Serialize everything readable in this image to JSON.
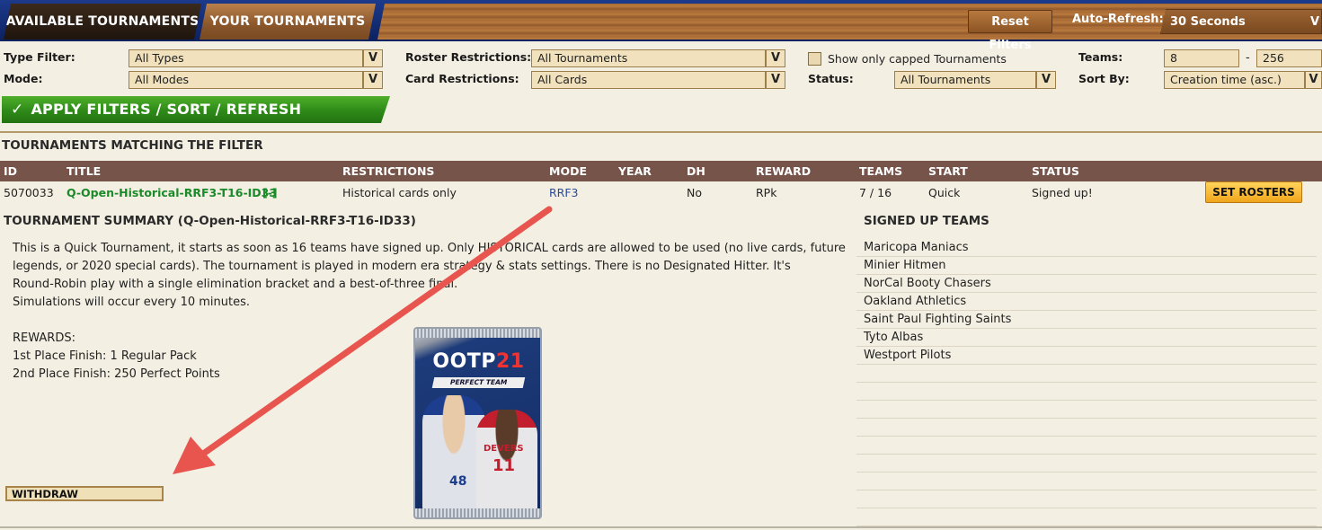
{
  "tabs": {
    "available": "AVAILABLE TOURNAMENTS",
    "yours": "YOUR TOURNAMENTS"
  },
  "toolbar": {
    "reset_filters": "Reset Filters",
    "auto_refresh_label": "Auto-Refresh:",
    "auto_refresh_value": "30 Seconds"
  },
  "filters": {
    "type_filter_label": "Type Filter:",
    "type_filter_value": "All Types",
    "mode_label": "Mode:",
    "mode_value": "All Modes",
    "roster_restrictions_label": "Roster Restrictions:",
    "roster_restrictions_value": "All Tournaments",
    "card_restrictions_label": "Card Restrictions:",
    "card_restrictions_value": "All Cards",
    "capped_checkbox_label": "Show only capped Tournaments",
    "capped_checked": false,
    "status_label": "Status:",
    "status_value": "All Tournaments",
    "teams_label": "Teams:",
    "teams_min": "8",
    "teams_separator": "-",
    "teams_max": "256",
    "sort_by_label": "Sort By:",
    "sort_by_value": "Creation time (asc.)",
    "dropdown_glyph": "V"
  },
  "apply_button": "APPLY FILTERS / SORT / REFRESH",
  "matching_title": "TOURNAMENTS MATCHING THE FILTER",
  "table": {
    "headers": [
      "ID",
      "TITLE",
      "RESTRICTIONS",
      "MODE",
      "YEAR",
      "DH",
      "REWARD",
      "TEAMS",
      "START",
      "STATUS"
    ],
    "row": {
      "id": "5070033",
      "title": "Q-Open-Historical-RRF3-T16-ID33",
      "toggle": "[-]",
      "restrictions": "Historical cards only",
      "mode": "RRF3",
      "year": "",
      "dh": "No",
      "reward": "RPk",
      "teams": "7 / 16",
      "start": "Quick",
      "status": "Signed up!",
      "action": "SET ROSTERS"
    }
  },
  "summary": {
    "title": "TOURNAMENT SUMMARY (Q-Open-Historical-RRF3-T16-ID33)",
    "lines": [
      "This is a Quick  Tournament, it starts as soon as 16  teams have signed up.  Only HISTORICAL cards are allowed to be used (no live cards, future",
      "legends, or 2020 special cards).  The tournament is played in modern era strategy & stats settings. There is no Designated Hitter. It's",
      "Round-Robin play with a single elimination bracket and a best-of-three final.",
      "Simulations will occur every 10 minutes.",
      "",
      "REWARDS:",
      "1st Place Finish: 1 Regular Pack",
      "2nd Place Finish: 250 Perfect Points"
    ],
    "withdraw": "WITHDRAW"
  },
  "pack": {
    "brand": "OOTP",
    "number": "21",
    "subtitle": "PERFECT TEAM",
    "player_left_number": "48",
    "player_right_name": "DEVERS",
    "player_right_number": "11"
  },
  "signed_up": {
    "title": "SIGNED UP TEAMS",
    "teams": [
      "Maricopa Maniacs",
      "Minier  Hitmen",
      "NorCal Booty Chasers",
      "Oakland Athletics",
      "Saint Paul Fighting Saints",
      "Tyto Albas",
      "Westport Pilots",
      "",
      "",
      "",
      "",
      "",
      "",
      "",
      "",
      ""
    ]
  },
  "colors": {
    "background": "#f3efe2",
    "table_header": "#76544a",
    "apply_green": "#2e8a18",
    "title_link": "#1a8a2a",
    "arrow": "#e8554f"
  }
}
